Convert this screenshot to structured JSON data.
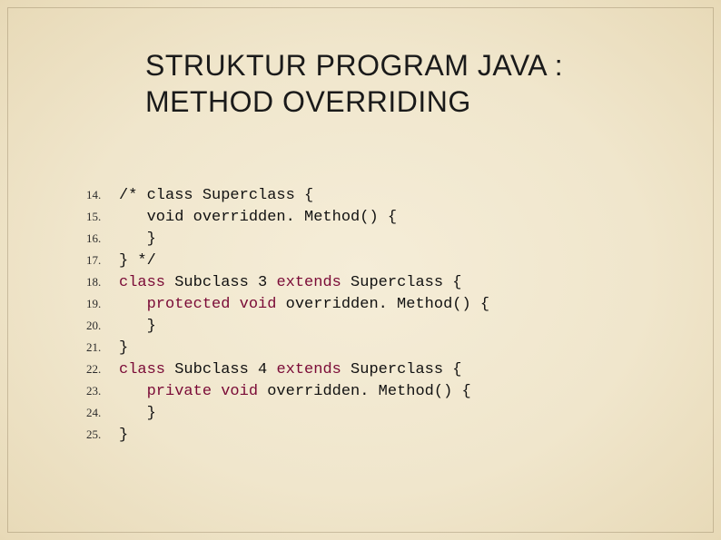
{
  "title": "STRUKTUR PROGRAM JAVA : METHOD OVERRIDING",
  "code": {
    "lines": [
      {
        "n": "14.",
        "tokens": [
          {
            "t": "/* class Superclass {",
            "c": "cmt"
          }
        ]
      },
      {
        "n": "15.",
        "tokens": [
          {
            "t": "   void overridden. Method() {",
            "c": "cmt"
          }
        ]
      },
      {
        "n": "16.",
        "tokens": [
          {
            "t": "   }",
            "c": "cmt"
          }
        ]
      },
      {
        "n": "17.",
        "tokens": [
          {
            "t": "} */",
            "c": "cmt"
          }
        ]
      },
      {
        "n": "18.",
        "tokens": [
          {
            "t": "class",
            "c": "kw"
          },
          {
            "t": " Subclass 3 "
          },
          {
            "t": "extends",
            "c": "kw"
          },
          {
            "t": " Superclass {"
          }
        ]
      },
      {
        "n": "19.",
        "tokens": [
          {
            "t": "   "
          },
          {
            "t": "protected void",
            "c": "kw"
          },
          {
            "t": " overridden. Method() {"
          }
        ]
      },
      {
        "n": "20.",
        "tokens": [
          {
            "t": "   }"
          }
        ]
      },
      {
        "n": "21.",
        "tokens": [
          {
            "t": "}"
          }
        ]
      },
      {
        "n": "22.",
        "tokens": [
          {
            "t": "class",
            "c": "kw"
          },
          {
            "t": " Subclass 4 "
          },
          {
            "t": "extends",
            "c": "kw"
          },
          {
            "t": " Superclass {"
          }
        ]
      },
      {
        "n": "23.",
        "tokens": [
          {
            "t": "   "
          },
          {
            "t": "private void",
            "c": "kw"
          },
          {
            "t": " overridden. Method() {"
          }
        ]
      },
      {
        "n": "24.",
        "tokens": [
          {
            "t": "   }"
          }
        ]
      },
      {
        "n": "25.",
        "tokens": [
          {
            "t": "}"
          }
        ]
      }
    ]
  }
}
